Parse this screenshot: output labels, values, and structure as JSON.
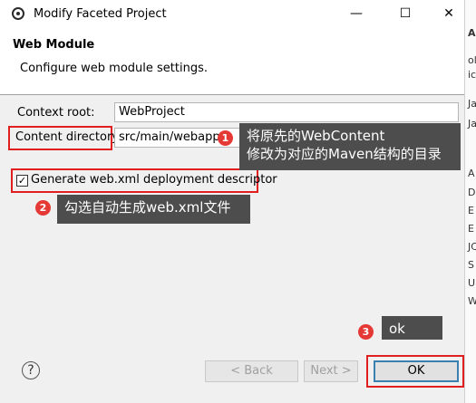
{
  "window": {
    "title": "Modify Faceted Project"
  },
  "header": {
    "title": "Web Module",
    "description": "Configure web module settings."
  },
  "form": {
    "context_root_label": "Context root:",
    "context_root_value": "WebProject",
    "content_dir_label": "Content directory:",
    "content_dir_value": "src/main/webapp",
    "generate_label": "Generate web.xml deployment descriptor",
    "generate_checked": true
  },
  "annotations": {
    "badge1": "1",
    "note1_line1": "将原先的WebContent",
    "note1_line2": "修改为对应的Maven结构的目录",
    "badge2": "2",
    "note2": "勾选自动生成web.xml文件",
    "badge3": "3",
    "note3": "ok"
  },
  "footer": {
    "help": "?",
    "back": "< Back",
    "next": "Next >",
    "ok": "OK"
  },
  "right_panel": {
    "chars": [
      "Ap",
      "ol",
      "ic",
      "Ja",
      "Ja",
      "A",
      "D",
      "E",
      "E",
      "JC",
      "S",
      "U",
      "W"
    ]
  }
}
